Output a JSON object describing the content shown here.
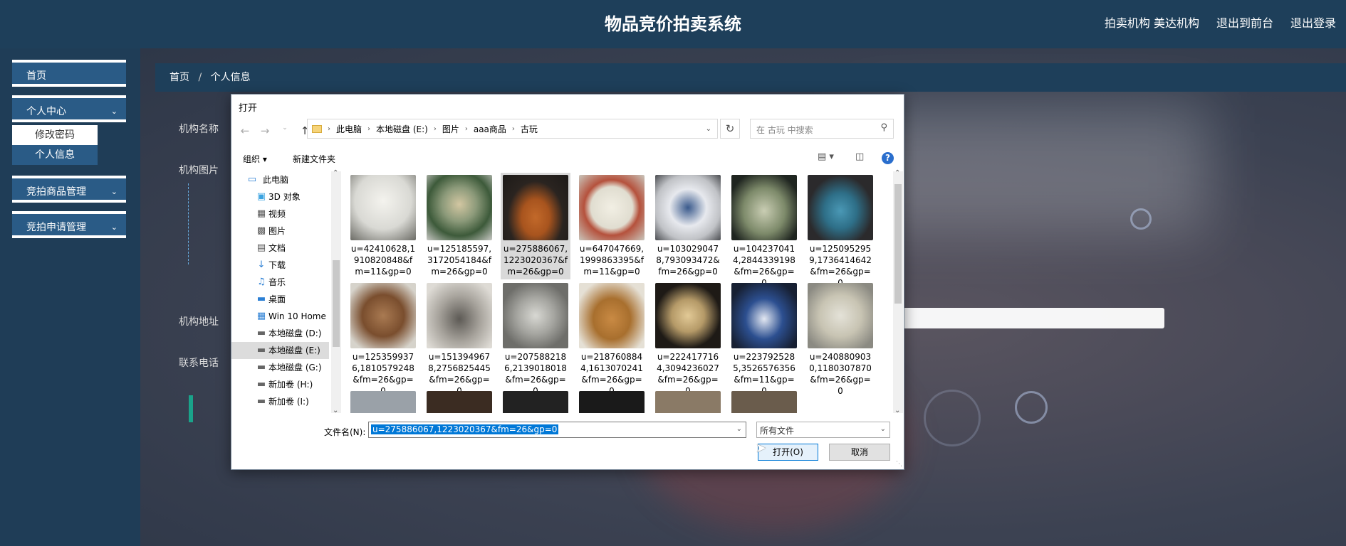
{
  "header": {
    "title": "物品竞价拍卖系统",
    "nav": [
      "拍卖机构 美达机构",
      "退出到前台",
      "退出登录"
    ]
  },
  "sidebar": {
    "items": [
      {
        "label": "首页"
      },
      {
        "label": "个人中心",
        "chevron": "chevron-down-icon"
      },
      {
        "label": "竞拍商品管理",
        "chevron": "chevron-down-icon"
      },
      {
        "label": "竞拍申请管理",
        "chevron": "chevron-down-icon"
      }
    ],
    "submenu": [
      "修改密码",
      "个人信息"
    ]
  },
  "main": {
    "breadcrumb": {
      "home": "首页",
      "separator": "/",
      "current": "个人信息"
    },
    "form_labels": [
      "机构名称",
      "机构图片",
      "机构地址",
      "联系电话"
    ]
  },
  "dialog": {
    "title": "打开",
    "path": [
      "此电脑",
      "本地磁盘 (E:)",
      "图片",
      "aaa商品",
      "古玩"
    ],
    "search_placeholder": "在 古玩 中搜索",
    "toolbar": {
      "organize": "组织 ▾",
      "new_folder": "新建文件夹",
      "help": "?"
    },
    "tree": [
      {
        "label": "此电脑",
        "icon": "pc-icon"
      },
      {
        "label": "3D 对象",
        "icon": "cube-icon"
      },
      {
        "label": "视频",
        "icon": "video-icon"
      },
      {
        "label": "图片",
        "icon": "picture-icon"
      },
      {
        "label": "文档",
        "icon": "document-icon"
      },
      {
        "label": "下载",
        "icon": "download-icon"
      },
      {
        "label": "音乐",
        "icon": "music-icon"
      },
      {
        "label": "桌面",
        "icon": "desktop-icon"
      },
      {
        "label": "Win 10 Home ›",
        "icon": "drive-icon"
      },
      {
        "label": "本地磁盘 (D:)",
        "icon": "drive-icon"
      },
      {
        "label": "本地磁盘 (E:)",
        "icon": "drive-icon"
      },
      {
        "label": "本地磁盘 (G:)",
        "icon": "drive-icon"
      },
      {
        "label": "新加卷 (H:)",
        "icon": "drive-icon"
      },
      {
        "label": "新加卷 (I:)",
        "icon": "drive-icon"
      }
    ],
    "files": [
      {
        "name": "u=42410628,1910820848&fm=11&gp=0",
        "color": "#d9d9d4"
      },
      {
        "name": "u=125185597,3172054184&fm=26&gp=0",
        "color": "#8c9a7a"
      },
      {
        "name": "u=275886067,1223020367&fm=26&gp=0",
        "color": "#a8541e"
      },
      {
        "name": "u=647047669,1999863395&fm=11&gp=0",
        "color": "#e0ddd0"
      },
      {
        "name": "u=1030290478,793093472&fm=26&gp=0",
        "color": "#3a5a8c"
      },
      {
        "name": "u=1042370414,2844339198&fm=26&gp=0",
        "color": "#7d8a6a"
      },
      {
        "name": "u=1250952959,1736414642&fm=26&gp=0",
        "color": "#2e6f88"
      },
      {
        "name": "u=1253599376,1810579248&fm=26&gp=0",
        "color": "#7a4e2e"
      },
      {
        "name": "u=1513949678,2756825445&fm=26&gp=0",
        "color": "#a7a39c"
      },
      {
        "name": "u=2075882186,2139018018&fm=26&gp=0",
        "color": "#a5a5a0"
      },
      {
        "name": "u=2187608844,1613070241&fm=26&gp=0",
        "color": "#a86f2e"
      },
      {
        "name": "u=2224177164,3094236027&fm=26&gp=0",
        "color": "#b59a68"
      },
      {
        "name": "u=2237925285,3526576356&fm=11&gp=0",
        "color": "#2c4f90"
      },
      {
        "name": "u=2408809030,1180307870&fm=26&gp=0",
        "color": "#c8c4b3"
      }
    ],
    "file_name_label": "文件名(N):",
    "file_name_value": "u=275886067,1223020367&fm=26&gp=0",
    "filter_value": "所有文件",
    "open_label": "打开(O)",
    "cancel_label": "取消"
  }
}
